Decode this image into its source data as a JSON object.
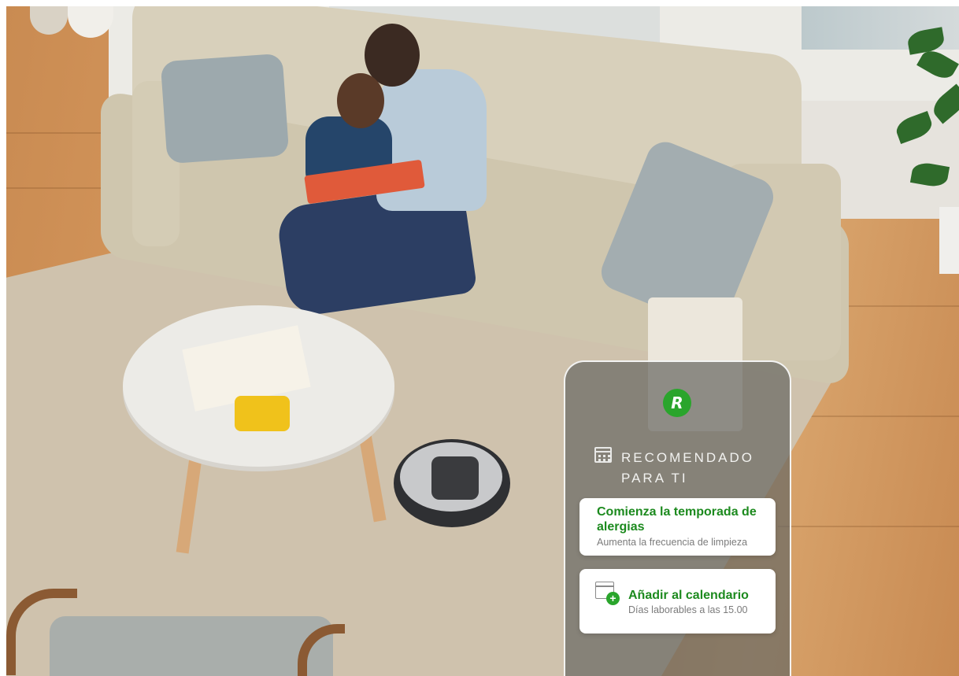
{
  "overlay": {
    "app_logo_letter": "R",
    "section_title": "RECOMENDADO PARA TI",
    "cards": [
      {
        "title": "Comienza la temporada de alergias",
        "subtitle": "Aumenta la frecuencia de limpieza"
      },
      {
        "title": "Añadir al calendario",
        "subtitle": "Días laborables a las 15.00",
        "icon": "calendar-plus-icon",
        "plus_symbol": "+"
      }
    ]
  },
  "colors": {
    "accent_green": "#1c8a1e",
    "logo_green": "#2aa52c",
    "subtitle_gray": "#7b7b7b"
  }
}
